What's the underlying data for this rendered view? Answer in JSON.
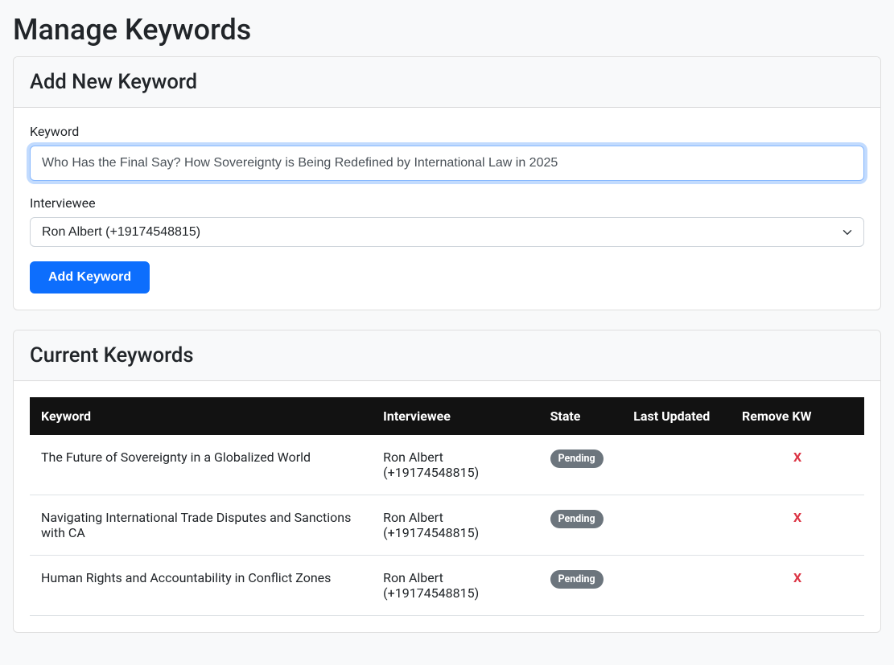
{
  "page": {
    "title": "Manage Keywords"
  },
  "addForm": {
    "header": "Add New Keyword",
    "keywordLabel": "Keyword",
    "keywordValue": "Who Has the Final Say? How Sovereignty is Being Redefined by International Law in 2025",
    "intervieweeLabel": "Interviewee",
    "intervieweeSelected": "Ron Albert (+19174548815)",
    "submitLabel": "Add Keyword"
  },
  "currentSection": {
    "header": "Current Keywords",
    "columns": {
      "keyword": "Keyword",
      "interviewee": "Interviewee",
      "state": "State",
      "lastUpdated": "Last Updated",
      "remove": "Remove KW"
    },
    "rows": [
      {
        "keyword": "The Future of Sovereignty in a Globalized World",
        "interviewee": "Ron Albert (+19174548815)",
        "state": "Pending",
        "lastUpdated": "",
        "remove": "X"
      },
      {
        "keyword": "Navigating International Trade Disputes and Sanctions with CA",
        "interviewee": "Ron Albert (+19174548815)",
        "state": "Pending",
        "lastUpdated": "",
        "remove": "X"
      },
      {
        "keyword": "Human Rights and Accountability in Conflict Zones",
        "interviewee": "Ron Albert (+19174548815)",
        "state": "Pending",
        "lastUpdated": "",
        "remove": "X"
      }
    ]
  }
}
